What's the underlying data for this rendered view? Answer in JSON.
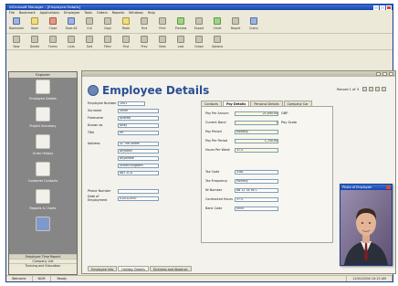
{
  "window": {
    "title": "AIOcrosoft Manager – [Employee Details]"
  },
  "menu": [
    "File",
    "Bookmark",
    "Applications",
    "Employee",
    "Tools",
    "Orders",
    "Reports",
    "Windows",
    "Help"
  ],
  "toolbar1": [
    {
      "label": "Bookmark",
      "icon": "bookmark-icon",
      "color": "blue"
    },
    {
      "label": "Open",
      "icon": "open-folder-icon",
      "color": "yellow"
    },
    {
      "label": "Close",
      "icon": "close-doc-icon",
      "color": "red"
    },
    {
      "label": "Save All",
      "icon": "save-icon",
      "color": "blue"
    },
    {
      "label": "Cut",
      "icon": "cut-icon",
      "color": ""
    },
    {
      "label": "Copy",
      "icon": "copy-icon",
      "color": ""
    },
    {
      "label": "Paste",
      "icon": "paste-icon",
      "color": "yellow"
    },
    {
      "label": "Find",
      "icon": "find-icon",
      "color": ""
    },
    {
      "label": "Print",
      "icon": "print-icon",
      "color": ""
    },
    {
      "label": "Preview",
      "icon": "preview-icon",
      "color": "green"
    },
    {
      "label": "Export",
      "icon": "export-icon",
      "color": ""
    },
    {
      "label": "Chart",
      "icon": "chart-icon",
      "color": "green"
    },
    {
      "label": "Report",
      "icon": "report-icon",
      "color": ""
    },
    {
      "label": "Query",
      "icon": "query-icon",
      "color": "blue"
    }
  ],
  "toolbar2": [
    {
      "label": "New",
      "icon": "new-icon"
    },
    {
      "label": "Delete",
      "icon": "delete-icon"
    },
    {
      "label": "Forms",
      "icon": "forms-icon"
    },
    {
      "label": "Lists",
      "icon": "lists-icon"
    },
    {
      "label": "Sort",
      "icon": "sort-icon"
    },
    {
      "label": "Filter",
      "icon": "filter-icon"
    },
    {
      "label": "First",
      "icon": "first-record-icon"
    },
    {
      "label": "Prev",
      "icon": "prev-record-icon"
    },
    {
      "label": "Next",
      "icon": "next-record-icon"
    },
    {
      "label": "Last",
      "icon": "last-record-icon"
    },
    {
      "label": "Graph",
      "icon": "graph-icon"
    },
    {
      "label": "Options",
      "icon": "options-icon"
    }
  ],
  "sidebar": {
    "header": "Explorer",
    "items": [
      {
        "label": "Employee Details",
        "icon": "employee-icon"
      },
      {
        "label": "Project Summary",
        "icon": "project-icon"
      },
      {
        "label": "Order History",
        "icon": "orders-icon"
      },
      {
        "label": "Customer Contacts",
        "icon": "contacts-icon"
      },
      {
        "label": "Reports & Charts",
        "icon": "reports-icon"
      },
      {
        "label": "",
        "icon": "people-icon"
      }
    ],
    "bottom": [
      "Employee Time Report",
      "Company List",
      "Training and Education"
    ]
  },
  "form": {
    "title": "Employee Details",
    "record": "Record 1 of 3",
    "fields": [
      {
        "label": "Employee Number",
        "value": "1001",
        "width": 30
      },
      {
        "label": "Surname",
        "value": "Smith",
        "width": 45
      },
      {
        "label": "Forename",
        "value": "Andrew",
        "width": 45
      },
      {
        "label": "Known as",
        "value": "Andy",
        "width": 45
      },
      {
        "label": "Title",
        "value": "Mr",
        "width": 45
      },
      {
        "label": "Address",
        "value": "42 The Street",
        "width": 45
      },
      {
        "label": "",
        "value": "Anytown",
        "width": 45
      },
      {
        "label": "",
        "value": "Anywhere",
        "width": 45
      },
      {
        "label": "",
        "value": "United Kingdom",
        "width": 45
      },
      {
        "label": "",
        "value": "AB1 2CD",
        "width": 45
      },
      {
        "label": "Phone Number",
        "value": "",
        "width": 45
      },
      {
        "label": "Date of Employment",
        "value": "01/01/2000",
        "width": 45
      }
    ],
    "tabs": [
      "Contacts",
      "Pay Details",
      "Personal Details",
      "Company Car"
    ],
    "active_tab": "Pay Details",
    "pay": [
      {
        "label": "Pay Per Annum",
        "value": "21,000.00",
        "suffix": "GBP"
      },
      {
        "label": "Current Band",
        "value": "3",
        "suffix": "Pay Scale"
      },
      {
        "label": "Pay Period",
        "value": "Monthly",
        "suffix": ""
      },
      {
        "label": "Pay Per Period",
        "value": "1,750.00",
        "suffix": ""
      },
      {
        "label": "Hours Per Week",
        "value": "37.5",
        "suffix": ""
      },
      {
        "label": "Tax Code",
        "value": "438L",
        "suffix": ""
      },
      {
        "label": "Tax Frequency",
        "value": "Monthly",
        "suffix": ""
      },
      {
        "label": "NI Number",
        "value": "AB 12 34 56 C",
        "suffix": ""
      },
      {
        "label": "Contracted Hours",
        "value": "37.5",
        "suffix": ""
      },
      {
        "label": "Bank Code",
        "value": "0000",
        "suffix": ""
      }
    ],
    "bottom_tabs": [
      "Employee Info",
      "Holiday Details",
      "Sickness and Absence"
    ],
    "photo_title": "Photo of Employee"
  },
  "status": [
    "Welcome",
    "NUM",
    "Ready",
    "12/01/2004 10:15 AM"
  ]
}
